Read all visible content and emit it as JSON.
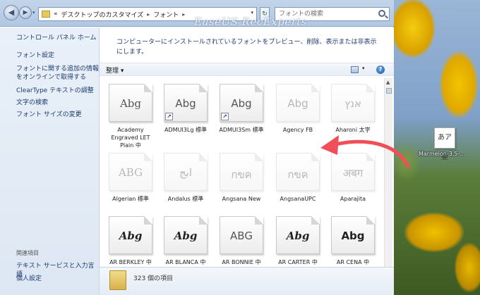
{
  "address": {
    "prefix": "«",
    "crumbs": [
      "デスクトップのカスタマイズ",
      "フォント"
    ],
    "separator": "▸"
  },
  "search": {
    "placeholder": "フォントの検索"
  },
  "watermark": "EaseUS RecExperts",
  "sidebar": {
    "links": [
      "コントロール パネル ホーム",
      "フォント設定",
      "フォントに関する追加の情報\nをオンラインで取得する",
      "ClearType テキストの調整",
      "文字の検索",
      "フォント サイズの変更"
    ],
    "see_also_title": "関連項目",
    "see_also": [
      "テキスト サービスと入力言語",
      "個人設定"
    ]
  },
  "main": {
    "description": "コンピューターにインストールされているフォントをプレビュー、削除、表示または非表示にします。",
    "organize_label": "整理 ▾",
    "help_label": "?",
    "status_count": "323 個の項目"
  },
  "fonts": [
    {
      "name": "Academy Engraved LET Plain 中",
      "sample": "Abg",
      "style": "serif",
      "hidden": false,
      "shortcut": false
    },
    {
      "name": "ADMUI3Lg 標準",
      "sample": "Abg",
      "style": "sans",
      "hidden": false,
      "shortcut": true
    },
    {
      "name": "ADMUI3Sm 標準",
      "sample": "Abg",
      "style": "sans",
      "hidden": false,
      "shortcut": true
    },
    {
      "name": "Agency FB",
      "sample": "Abg",
      "style": "sans",
      "hidden": true,
      "shortcut": false
    },
    {
      "name": "Aharoni 太字",
      "sample": "אנץ",
      "style": "sans",
      "hidden": true,
      "shortcut": false
    },
    {
      "name": "Algerian 標準",
      "sample": "ABG",
      "style": "serif",
      "hidden": true,
      "shortcut": false
    },
    {
      "name": "Andalus 標準",
      "sample": "ابج",
      "style": "serif",
      "hidden": true,
      "shortcut": false
    },
    {
      "name": "Angsana New",
      "sample": "กขค",
      "style": "sans",
      "hidden": true,
      "shortcut": false
    },
    {
      "name": "AngsanaUPC",
      "sample": "กขค",
      "style": "sans",
      "hidden": true,
      "shortcut": false
    },
    {
      "name": "Aparajita",
      "sample": "अबग",
      "style": "serif",
      "hidden": true,
      "shortcut": false
    },
    {
      "name": "AR BERKLEY 中",
      "sample": "Abg",
      "style": "italic",
      "hidden": false,
      "shortcut": false
    },
    {
      "name": "AR BLANCA 中",
      "sample": "Abg",
      "style": "italic",
      "hidden": false,
      "shortcut": false
    },
    {
      "name": "AR BONNIE 中",
      "sample": "ABG",
      "style": "sans",
      "hidden": false,
      "shortcut": false
    },
    {
      "name": "AR CARTER 中",
      "sample": "Abg",
      "style": "italic",
      "hidden": false,
      "shortcut": false
    },
    {
      "name": "AR CENA 中",
      "sample": "Abg",
      "style": "bold",
      "hidden": false,
      "shortcut": false
    }
  ],
  "desktop_icon": {
    "glyph": "あア亜",
    "label": "Marmelon-3.5-..."
  },
  "colors": {
    "arrow": "#f04f5a",
    "link": "#1e3a6e",
    "sidebar_bg": "#e9f0f9"
  }
}
